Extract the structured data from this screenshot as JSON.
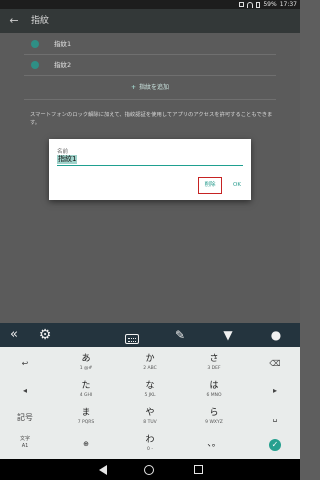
{
  "status_bar": {
    "battery": "59%",
    "time": "17:37"
  },
  "app_bar": {
    "title": "指紋",
    "back_icon": "arrow-back-icon"
  },
  "fingerprints": [
    {
      "label": "指紋1"
    },
    {
      "label": "指紋2"
    }
  ],
  "add_fingerprint": {
    "plus": "+",
    "label": "指紋を追加"
  },
  "description": "スマートフォンのロック解除に加えて、指紋認証を使用してアプリのアクセスを許可することもできます。",
  "dialog": {
    "field_label": "名前",
    "name_value": "指紋1",
    "delete_label": "削除",
    "ok_label": "OK"
  },
  "keyboard_toolbar": {
    "collapse_icon": "double-chevron-left-icon",
    "settings_icon": "gear-icon",
    "keyboard_icon": "keyboard-icon",
    "memo_icon": "memo-icon",
    "shirt_icon": "shirt-icon",
    "mic_icon": "microphone-icon"
  },
  "keyboard": {
    "left_keys": {
      "undo": "↩",
      "left": "◂",
      "kigou": "記号",
      "mode_main": "文字",
      "mode_sub": "A1"
    },
    "right_keys": {
      "backspace": "⌫",
      "right": "▸",
      "space": "␣",
      "enter": "✓"
    },
    "rows": [
      [
        {
          "main": "あ",
          "sub": "1 @#"
        },
        {
          "main": "か",
          "sub": "2 ABC"
        },
        {
          "main": "さ",
          "sub": "3 DEF"
        }
      ],
      [
        {
          "main": "た",
          "sub": "4 GHI"
        },
        {
          "main": "な",
          "sub": "5 JKL"
        },
        {
          "main": "は",
          "sub": "6 MNO"
        }
      ],
      [
        {
          "main": "ま",
          "sub": "7 PQRS"
        },
        {
          "main": "や",
          "sub": "8 TUV"
        },
        {
          "main": "ら",
          "sub": "9 WXYZ"
        }
      ],
      [
        {
          "main": "⊕",
          "sub": ""
        },
        {
          "main": "わ",
          "sub": "0 -"
        },
        {
          "main": "、。",
          "sub": ""
        }
      ]
    ]
  },
  "colors": {
    "accent": "#2a9d8f",
    "highlight": "#c62323",
    "toolbar": "#24343e"
  }
}
